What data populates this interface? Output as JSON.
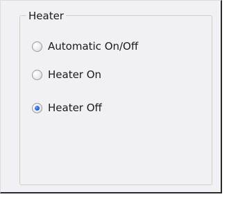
{
  "group": {
    "title": "Heater",
    "options": [
      {
        "label": "Automatic On/Off",
        "selected": false
      },
      {
        "label": "Heater On",
        "selected": false
      },
      {
        "label": "Heater Off",
        "selected": true
      }
    ]
  },
  "colors": {
    "panel_background": "#f1f0f4",
    "selected_dot": "#1f5fd6"
  }
}
